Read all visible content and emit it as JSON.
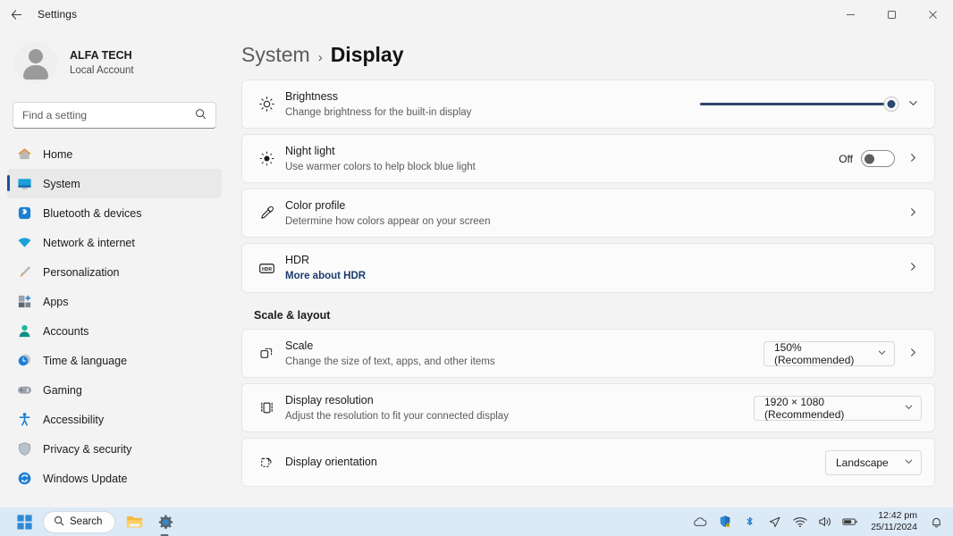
{
  "titlebar": {
    "back_icon": "back-arrow-icon",
    "title": "Settings",
    "minimize": "minimize-icon",
    "maximize": "maximize-icon",
    "close": "close-icon"
  },
  "sidebar": {
    "account": {
      "name": "ALFA TECH",
      "subtitle": "Local Account"
    },
    "search": {
      "placeholder": "Find a setting",
      "value": "",
      "icon": "search-icon"
    },
    "items": [
      {
        "label": "Home",
        "icon": "home-icon",
        "selected": false
      },
      {
        "label": "System",
        "icon": "system-monitor-icon",
        "selected": true
      },
      {
        "label": "Bluetooth & devices",
        "icon": "bluetooth-icon",
        "selected": false
      },
      {
        "label": "Network & internet",
        "icon": "wifi-icon",
        "selected": false
      },
      {
        "label": "Personalization",
        "icon": "paintbrush-icon",
        "selected": false
      },
      {
        "label": "Apps",
        "icon": "apps-icon",
        "selected": false
      },
      {
        "label": "Accounts",
        "icon": "account-person-icon",
        "selected": false
      },
      {
        "label": "Time & language",
        "icon": "clock-globe-icon",
        "selected": false
      },
      {
        "label": "Gaming",
        "icon": "gamepad-icon",
        "selected": false
      },
      {
        "label": "Accessibility",
        "icon": "accessibility-person-icon",
        "selected": false
      },
      {
        "label": "Privacy & security",
        "icon": "shield-icon",
        "selected": false
      },
      {
        "label": "Windows Update",
        "icon": "update-refresh-icon",
        "selected": false
      }
    ]
  },
  "breadcrumb": {
    "parent": "System",
    "separator": "›",
    "current": "Display"
  },
  "display": {
    "brightness": {
      "title": "Brightness",
      "subtitle": "Change brightness for the built-in display",
      "icon": "brightness-sun-icon",
      "slider_percent": 98,
      "expand_icon": "chevron-down-icon"
    },
    "night_light": {
      "title": "Night light",
      "subtitle": "Use warmer colors to help block blue light",
      "icon": "night-light-sun-icon",
      "toggle_state": "Off",
      "chevron": "chevron-right-icon"
    },
    "color_profile": {
      "title": "Color profile",
      "subtitle": "Determine how colors appear on your screen",
      "icon": "eyedropper-icon",
      "chevron": "chevron-right-icon"
    },
    "hdr": {
      "title": "HDR",
      "link": "More about HDR",
      "icon": "hdr-badge-icon",
      "chevron": "chevron-right-icon"
    }
  },
  "scale_layout": {
    "heading": "Scale & layout",
    "scale": {
      "title": "Scale",
      "subtitle": "Change the size of text, apps, and other items",
      "icon": "scale-resize-icon",
      "value": "150% (Recommended)",
      "caret": "chevron-down-icon",
      "chevron": "chevron-right-icon"
    },
    "resolution": {
      "title": "Display resolution",
      "subtitle": "Adjust the resolution to fit your connected display",
      "icon": "display-resolution-icon",
      "value": "1920 × 1080 (Recommended)",
      "caret": "chevron-down-icon"
    },
    "orientation": {
      "title": "Display orientation",
      "icon": "orientation-rotate-icon",
      "value": "Landscape",
      "caret": "chevron-down-icon"
    }
  },
  "taskbar": {
    "start": "windows-start-icon",
    "search_label": "Search",
    "search_icon": "search-icon",
    "file_explorer": "file-explorer-icon",
    "settings": "settings-gear-icon",
    "tray": [
      "onedrive-cloud-icon",
      "defender-shield-warning-icon",
      "bluetooth-icon",
      "send-arrow-icon",
      "wifi-icon",
      "volume-icon",
      "battery-icon"
    ],
    "clock_time": "12:42 pm",
    "clock_date": "25/11/2024",
    "notification_icon": "bell-icon"
  },
  "colors": {
    "accent": "#1b4f9c",
    "slider_fill": "#2c4668",
    "taskbar_bg": "#dce9f7",
    "page_bg": "#f3f3f3",
    "card_bg": "#fbfbfb",
    "link": "#1c3c6e"
  }
}
